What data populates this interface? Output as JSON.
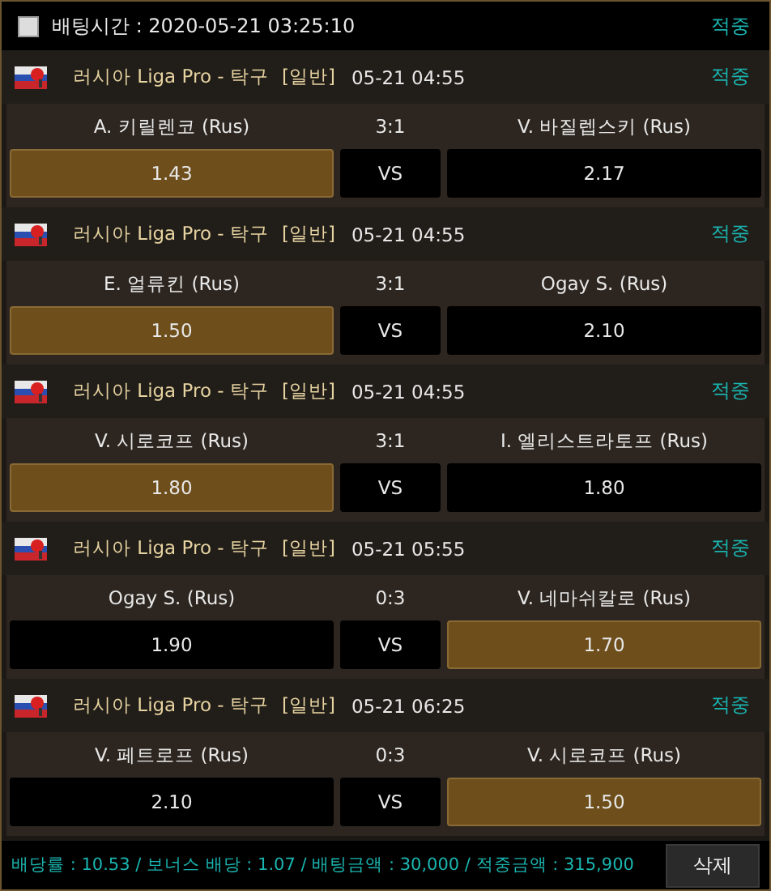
{
  "header": {
    "checked": false,
    "label": "배팅시간 : 2020-05-21 03:25:10",
    "status": "적중"
  },
  "matches": [
    {
      "league": "러시아 Liga Pro - 탁구",
      "type": "[일반]",
      "time": "05-21 04:55",
      "status": "적중",
      "home": "A. 키릴렌코 (Rus)",
      "score": "3:1",
      "away": "V. 바질렙스키 (Rus)",
      "home_odds": {
        "value": "1.43",
        "selected": true
      },
      "vs": "VS",
      "away_odds": {
        "value": "2.17",
        "selected": false
      }
    },
    {
      "league": "러시아 Liga Pro - 탁구",
      "type": "[일반]",
      "time": "05-21 04:55",
      "status": "적중",
      "home": "E. 얼류킨 (Rus)",
      "score": "3:1",
      "away": "Ogay S. (Rus)",
      "home_odds": {
        "value": "1.50",
        "selected": true
      },
      "vs": "VS",
      "away_odds": {
        "value": "2.10",
        "selected": false
      }
    },
    {
      "league": "러시아 Liga Pro - 탁구",
      "type": "[일반]",
      "time": "05-21 04:55",
      "status": "적중",
      "home": "V. 시로코프 (Rus)",
      "score": "3:1",
      "away": "I. 엘리스트라토프 (Rus)",
      "home_odds": {
        "value": "1.80",
        "selected": true
      },
      "vs": "VS",
      "away_odds": {
        "value": "1.80",
        "selected": false
      }
    },
    {
      "league": "러시아 Liga Pro - 탁구",
      "type": "[일반]",
      "time": "05-21 05:55",
      "status": "적중",
      "home": "Ogay S. (Rus)",
      "score": "0:3",
      "away": "V. 네마쉬칼로 (Rus)",
      "home_odds": {
        "value": "1.90",
        "selected": false
      },
      "vs": "VS",
      "away_odds": {
        "value": "1.70",
        "selected": true
      }
    },
    {
      "league": "러시아 Liga Pro - 탁구",
      "type": "[일반]",
      "time": "05-21 06:25",
      "status": "적중",
      "home": "V. 페트로프 (Rus)",
      "score": "0:3",
      "away": "V. 시로코프 (Rus)",
      "home_odds": {
        "value": "2.10",
        "selected": false
      },
      "vs": "VS",
      "away_odds": {
        "value": "1.50",
        "selected": true
      }
    }
  ],
  "footer": {
    "summary": "배당률 : 10.53 / 보너스 배당 : 1.07 / 배팅금액 : 30,000 / 적중금액 : 315,900",
    "delete_button": "삭제"
  }
}
